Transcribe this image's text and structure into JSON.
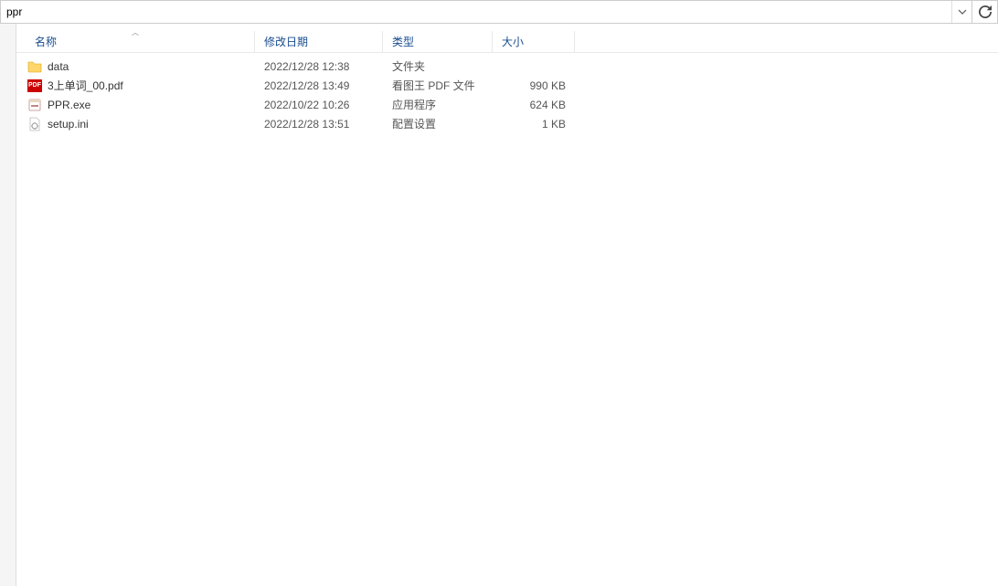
{
  "address": {
    "path": "ppr"
  },
  "columns": {
    "name": "名称",
    "date": "修改日期",
    "type": "类型",
    "size": "大小",
    "sort_by": "name",
    "sort_dir": "asc"
  },
  "files": [
    {
      "icon": "folder",
      "name": "data",
      "date": "2022/12/28 12:38",
      "type": "文件夹",
      "size": ""
    },
    {
      "icon": "pdf",
      "name": "3上单词_00.pdf",
      "date": "2022/12/28 13:49",
      "type": "看图王 PDF 文件",
      "size": "990 KB"
    },
    {
      "icon": "exe",
      "name": "PPR.exe",
      "date": "2022/10/22 10:26",
      "type": "应用程序",
      "size": "624 KB"
    },
    {
      "icon": "ini",
      "name": "setup.ini",
      "date": "2022/12/28 13:51",
      "type": "配置设置",
      "size": "1 KB"
    }
  ]
}
